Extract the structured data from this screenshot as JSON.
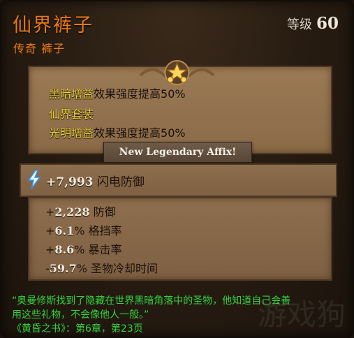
{
  "item": {
    "name": "仙界裤子",
    "subtitle": "传奇 裤子",
    "level_label": "等级",
    "level_value": "60"
  },
  "legendary_affixes": [
    {
      "highlight": "黑暗增益",
      "text": "效果强度提高50%"
    },
    {
      "highlight": "仙界套装",
      "text": ""
    },
    {
      "highlight": "光明增益",
      "text": "效果强度提高50%"
    }
  ],
  "banner": "New Legendary Affix!",
  "primary_stat": {
    "value": "+7,993",
    "label": "闪电防御"
  },
  "stats": [
    {
      "prefix": "+",
      "value": "2,228",
      "suffix": "",
      "label": "防御"
    },
    {
      "prefix": "+",
      "value": "6.1",
      "suffix": "%",
      "label": "格挡率"
    },
    {
      "prefix": "+",
      "value": "8.6",
      "suffix": "%",
      "label": "暴击率"
    },
    {
      "prefix": "-",
      "value": "59.7",
      "suffix": "%",
      "label": "圣物冷却时间"
    }
  ],
  "flavor": {
    "line1": "“奥曼修斯找到了隐藏在世界黑暗角落中的圣物，他知道自己会善",
    "line2": "用这些礼物，不会像他人一般。”",
    "line3": "《黄昏之书》：第6章，第23页"
  },
  "watermark": "游戏狗",
  "colors": {
    "rarity": "#e87a16",
    "affix_highlight": "#f2d23a",
    "flavor": "#36d33f",
    "value": "#f1e9d9"
  },
  "icons": {
    "star": "star-icon",
    "lightning": "lightning-icon"
  }
}
